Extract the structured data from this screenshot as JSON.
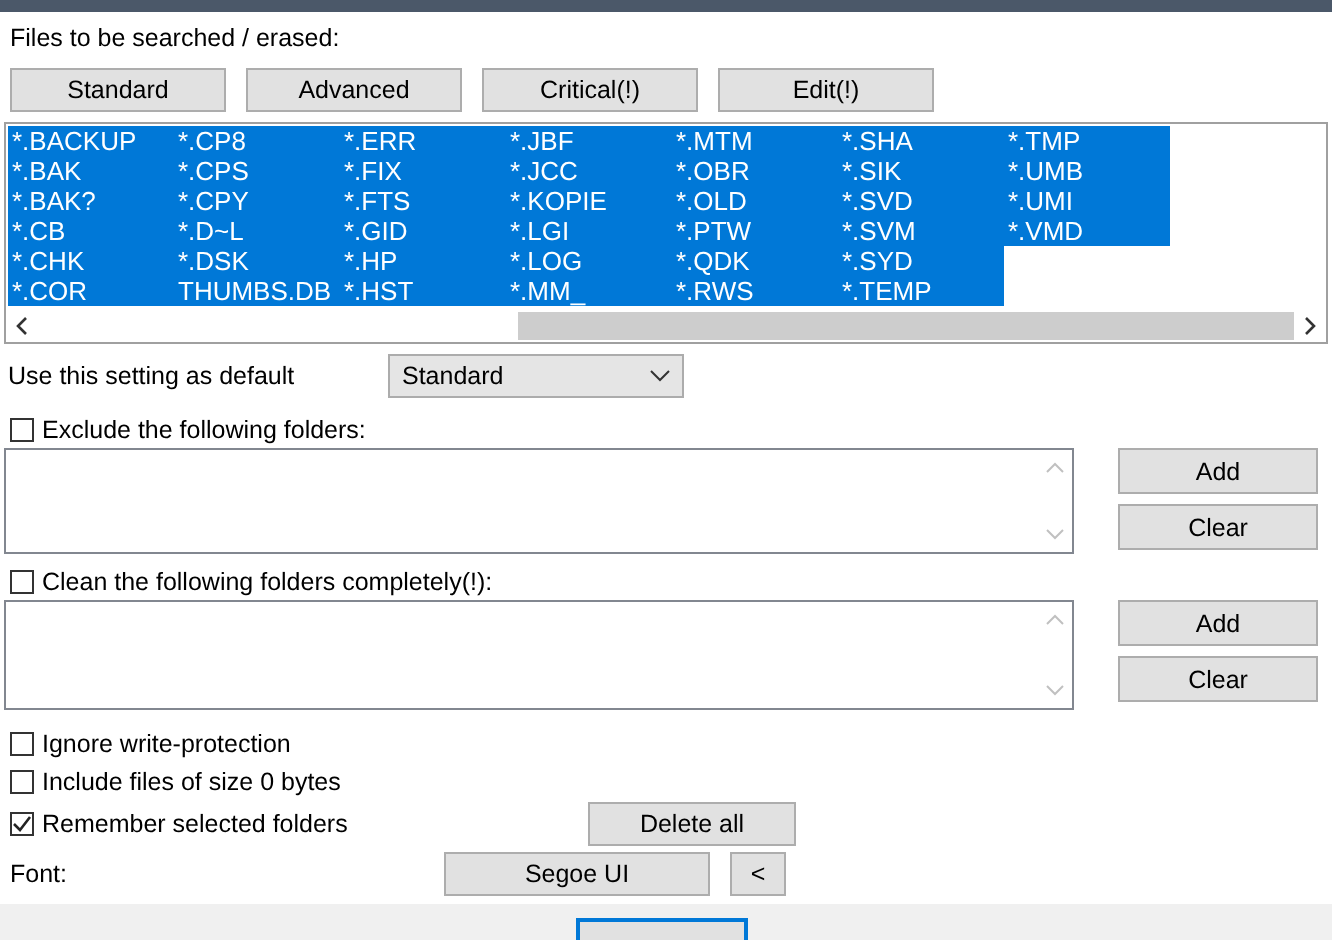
{
  "files_label": "Files to be searched / erased:",
  "preset_buttons": [
    "Standard",
    "Advanced",
    "Critical(!)",
    "Edit(!)"
  ],
  "file_list": {
    "columns": [
      [
        {
          "text": "*.BACKUP",
          "selected": true
        },
        {
          "text": "*.BAK",
          "selected": true
        },
        {
          "text": "*.BAK?",
          "selected": true
        },
        {
          "text": "*.CB",
          "selected": true
        },
        {
          "text": "*.CHK",
          "selected": true
        },
        {
          "text": "*.COR",
          "selected": true
        }
      ],
      [
        {
          "text": "*.CP8",
          "selected": true
        },
        {
          "text": "*.CPS",
          "selected": true
        },
        {
          "text": "*.CPY",
          "selected": true
        },
        {
          "text": "*.D~L",
          "selected": true
        },
        {
          "text": "*.DSK",
          "selected": true
        },
        {
          "text": "THUMBS.DB",
          "selected": true
        }
      ],
      [
        {
          "text": "*.ERR",
          "selected": true
        },
        {
          "text": "*.FIX",
          "selected": true
        },
        {
          "text": "*.FTS",
          "selected": true
        },
        {
          "text": "*.GID",
          "selected": true
        },
        {
          "text": "*.HP",
          "selected": true
        },
        {
          "text": "*.HST",
          "selected": true
        }
      ],
      [
        {
          "text": "*.JBF",
          "selected": true
        },
        {
          "text": "*.JCC",
          "selected": true
        },
        {
          "text": "*.KOPIE",
          "selected": true
        },
        {
          "text": "*.LGI",
          "selected": true
        },
        {
          "text": "*.LOG",
          "selected": true
        },
        {
          "text": "*.MM_",
          "selected": true
        }
      ],
      [
        {
          "text": "*.MTM",
          "selected": true
        },
        {
          "text": "*.OBR",
          "selected": true
        },
        {
          "text": "*.OLD",
          "selected": true
        },
        {
          "text": "*.PTW",
          "selected": true
        },
        {
          "text": "*.QDK",
          "selected": true
        },
        {
          "text": "*.RWS",
          "selected": true
        }
      ],
      [
        {
          "text": "*.SHA",
          "selected": true
        },
        {
          "text": "*.SIK",
          "selected": true
        },
        {
          "text": "*.SVD",
          "selected": true
        },
        {
          "text": "*.SVM",
          "selected": true
        },
        {
          "text": "*.SYD",
          "selected": true
        },
        {
          "text": "*.TEMP",
          "selected": true
        }
      ],
      [
        {
          "text": "*.TMP",
          "selected": true
        },
        {
          "text": "*.UMB",
          "selected": true
        },
        {
          "text": "*.UMI",
          "selected": true
        },
        {
          "text": "*.VMD",
          "selected": true
        }
      ]
    ]
  },
  "default_setting": {
    "label": "Use this setting as default",
    "value": "Standard"
  },
  "exclude": {
    "label": "Exclude the following folders:",
    "checked": false,
    "add": "Add",
    "clear": "Clear"
  },
  "clean": {
    "label": "Clean the following folders completely(!):",
    "checked": false,
    "add": "Add",
    "clear": "Clear"
  },
  "options": [
    {
      "label": "Ignore write-protection",
      "checked": false
    },
    {
      "label": "Include files of size 0 bytes",
      "checked": false
    },
    {
      "label": "Remember selected folders",
      "checked": true
    }
  ],
  "delete_all": "Delete all",
  "font": {
    "label": "Font:",
    "value": "Segoe UI",
    "button": "<"
  }
}
